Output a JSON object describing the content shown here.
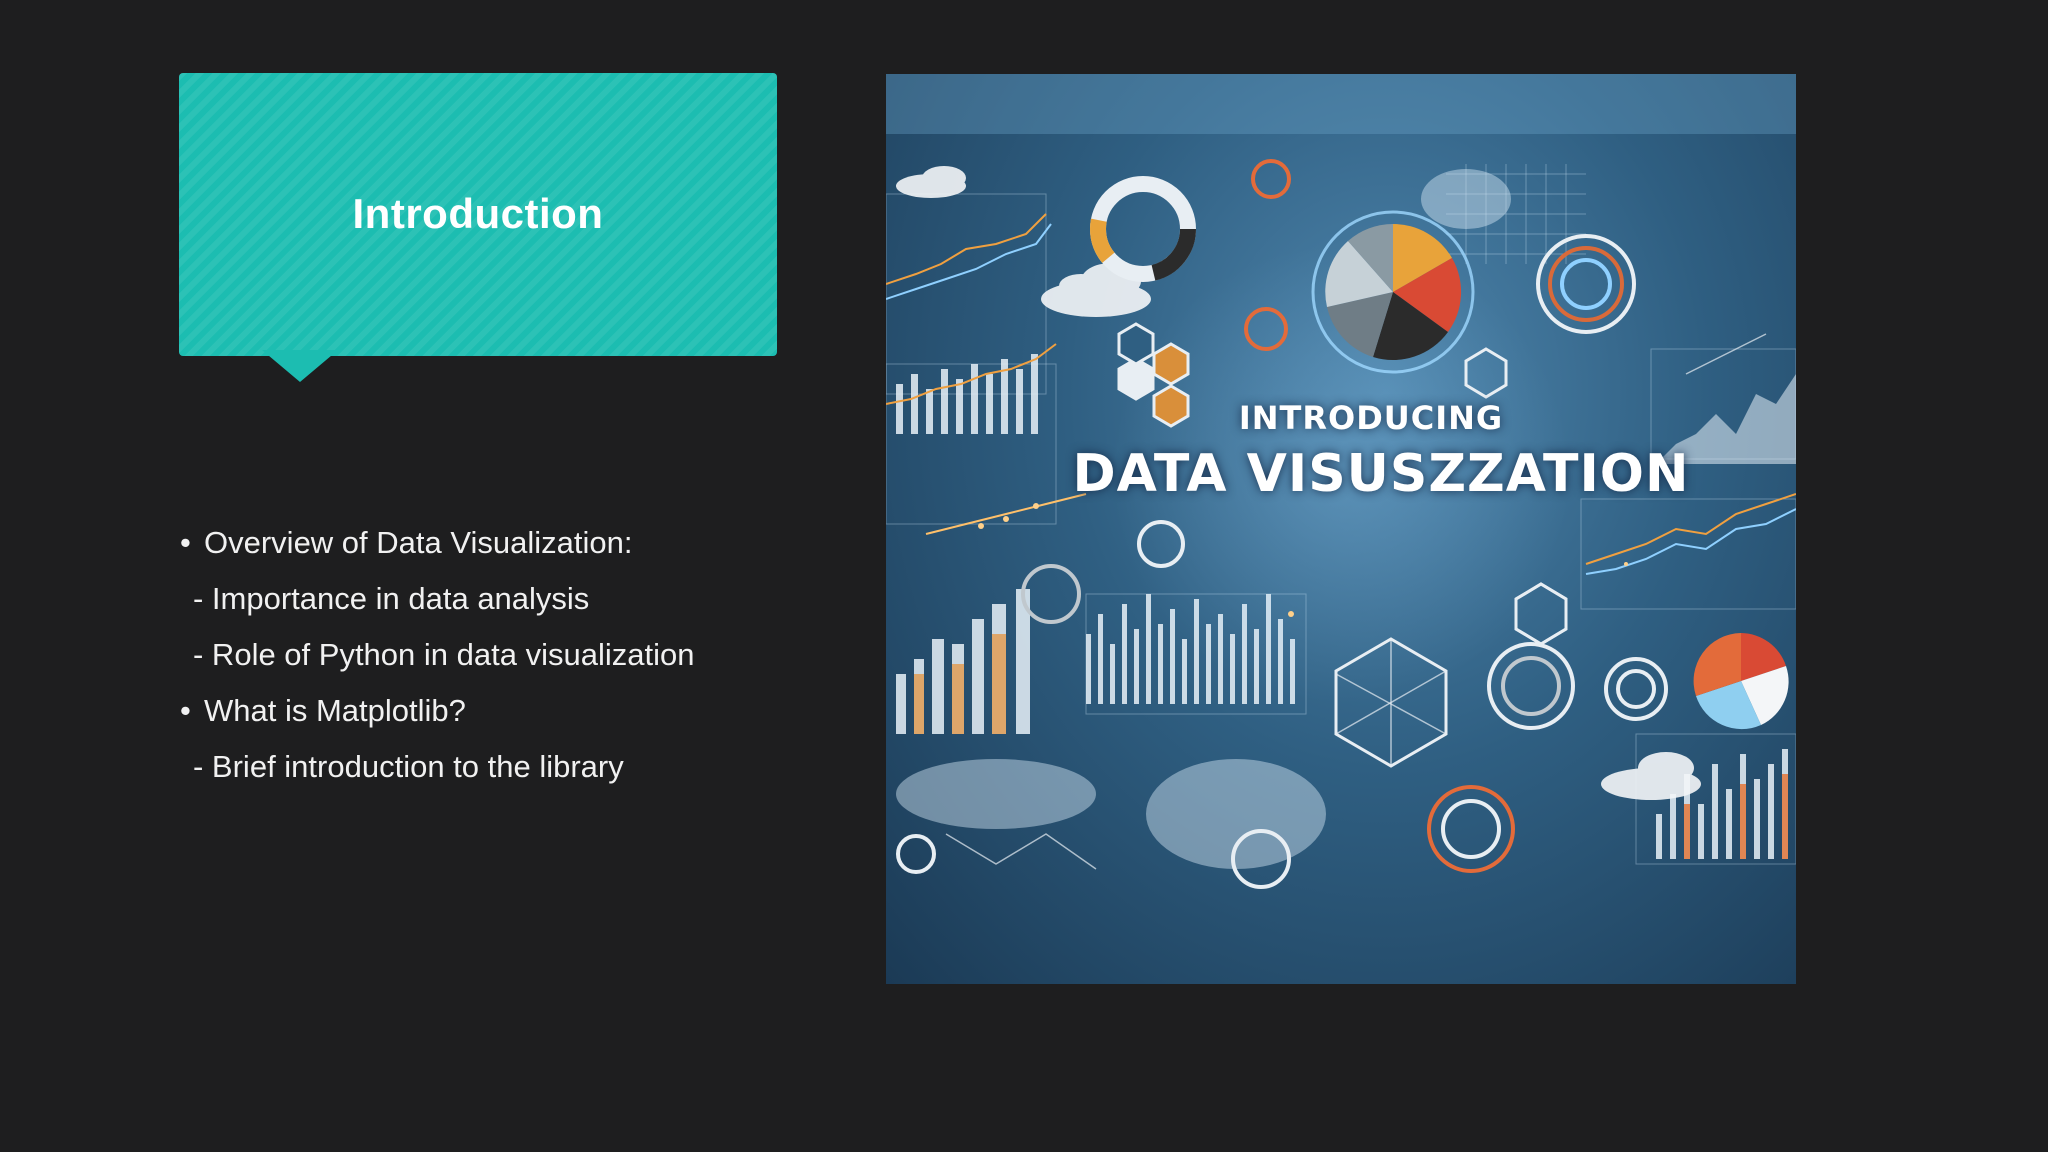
{
  "slide": {
    "title": "Introduction",
    "bullets": [
      {
        "kind": "bullet",
        "marker": "•",
        "text": "Overview of Data Visualization:"
      },
      {
        "kind": "sub",
        "text": "- Importance in data analysis"
      },
      {
        "kind": "sub",
        "text": "- Role of Python in data visualization"
      },
      {
        "kind": "bullet",
        "marker": "•",
        "text": "What is Matplotlib?"
      },
      {
        "kind": "sub",
        "text": "- Brief introduction to the library"
      }
    ],
    "picture": {
      "line1": "INTRODUCING",
      "line2": "DATA VISUSZZATION"
    }
  },
  "colors": {
    "background": "#1e1e1f",
    "accent": "#1cbdb1",
    "text": "#f1f1f1"
  }
}
